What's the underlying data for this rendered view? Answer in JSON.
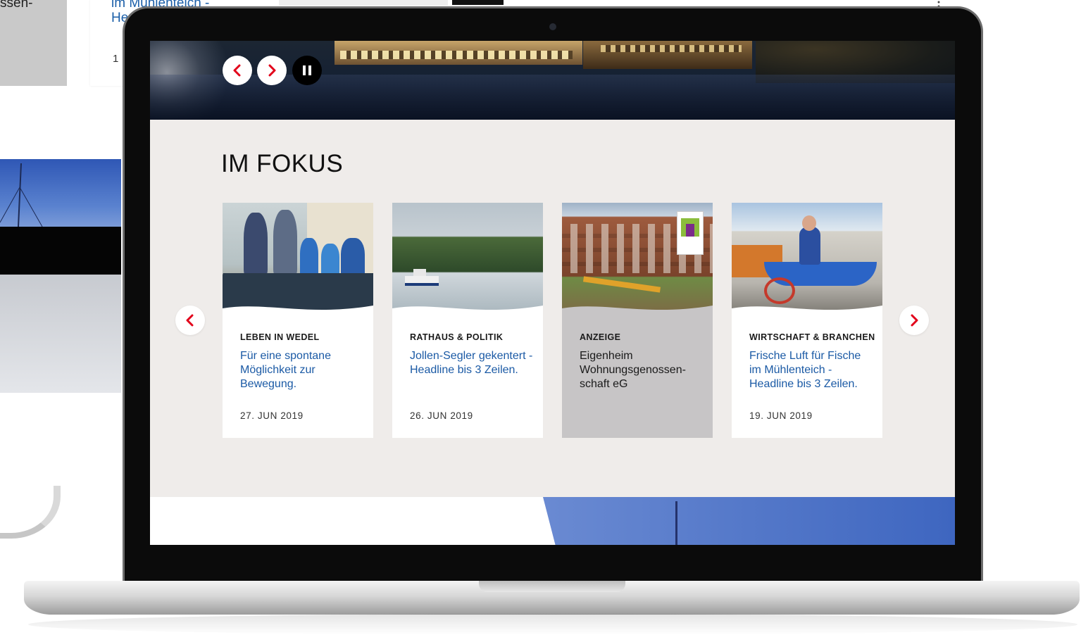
{
  "background": {
    "partial_text": "ssen-",
    "partial_link_line1": "im Mühlenteich -",
    "partial_link_line2": "He",
    "partial_date": "1"
  },
  "hero": {
    "prev_icon": "chevron-left-icon",
    "next_icon": "chevron-right-icon",
    "pause_icon": "pause-icon"
  },
  "section": {
    "title": "IM FOKUS"
  },
  "carousel": {
    "prev_icon": "chevron-left-icon",
    "next_icon": "chevron-right-icon",
    "cards": [
      {
        "category": "Leben in Wedel",
        "title": "Für eine spontane Möglichkeit zur Bewegung.",
        "date": "27. JUN 2019",
        "is_ad": false
      },
      {
        "category": "Rathaus & Politik",
        "title": "Jollen-Segler gekentert - Headline bis 3 Zeilen.",
        "date": "26. JUN 2019",
        "is_ad": false
      },
      {
        "category": "Anzeige",
        "title": "Eigenheim Wohnungsgenossen-schaft eG",
        "date": "",
        "is_ad": true
      },
      {
        "category": "Wirtschaft & Branchen",
        "title": "Frische Luft für Fische im Mühlenteich - Headline bis 3 Zeilen.",
        "date": "19. JUN 2019",
        "is_ad": false
      }
    ]
  },
  "colors": {
    "accent_red": "#e2001a",
    "link_blue": "#1b5aa5",
    "section_bg": "#efecea",
    "ad_card_bg": "#c7c5c6"
  }
}
